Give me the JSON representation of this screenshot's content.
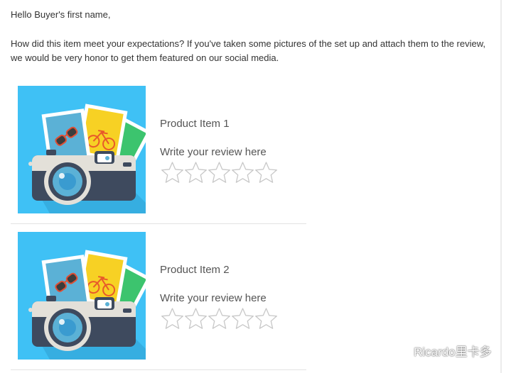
{
  "email": {
    "greeting": "Hello Buyer's first name,",
    "intro": "How did this item meet your expectations? If you've taken some pictures of the set up and attach them to the review, we would be very honor to get them featured on our social media."
  },
  "products": [
    {
      "name": "Product Item 1",
      "review_prompt": "Write your review here",
      "image_icon": "camera-with-photos-icon",
      "rating": 0,
      "max_rating": 5
    },
    {
      "name": "Product Item 2",
      "review_prompt": "Write your review here",
      "image_icon": "camera-with-photos-icon",
      "rating": 0,
      "max_rating": 5
    }
  ],
  "watermark": {
    "text": "Ricardo里卡多",
    "icon": "wechat-icon"
  },
  "colors": {
    "image_background": "#3fc1f5",
    "star_outline": "#cccccc",
    "divider": "#e3e3e3",
    "text": "#333333"
  }
}
